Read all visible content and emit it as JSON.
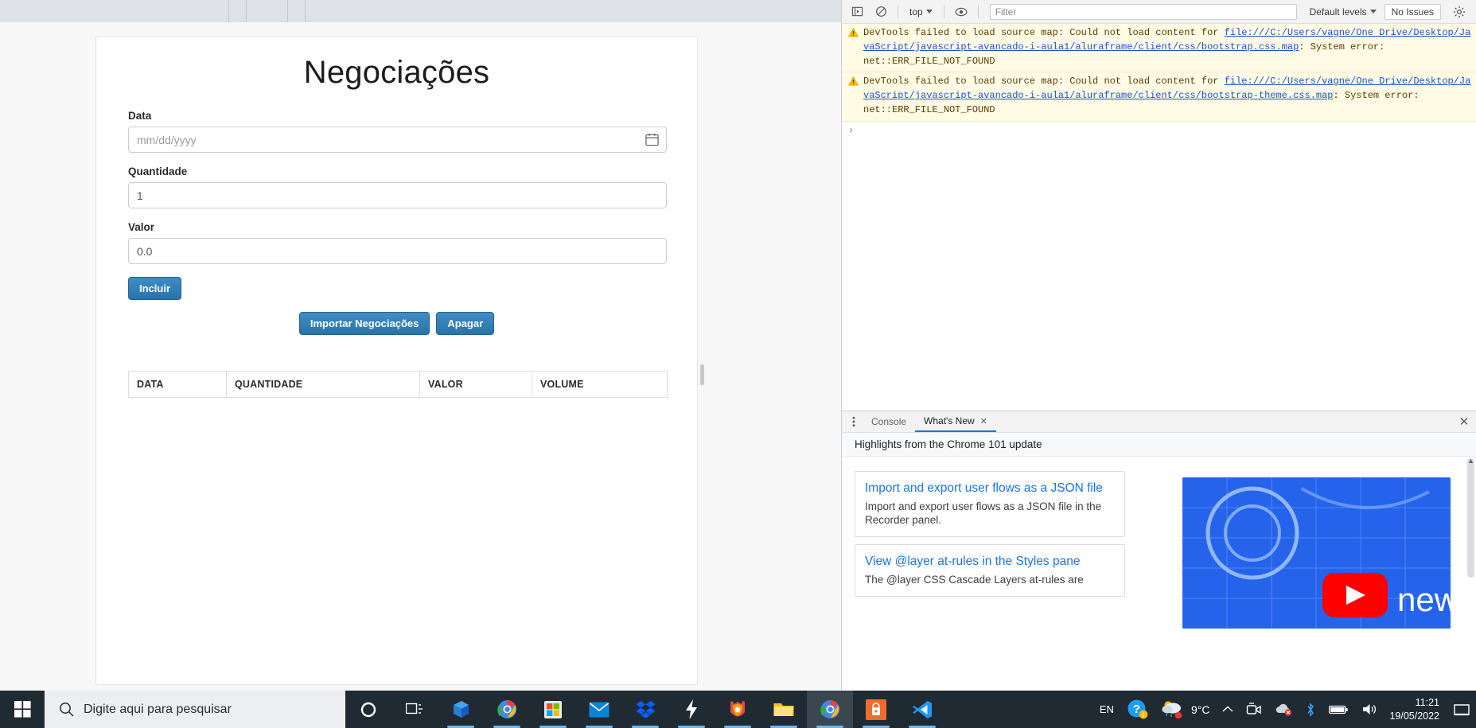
{
  "page": {
    "title": "Negociações",
    "fields": [
      {
        "label": "Data",
        "type": "date",
        "placeholder": "mm/dd/yyyy",
        "value": ""
      },
      {
        "label": "Quantidade",
        "type": "number",
        "placeholder": "",
        "value": "1"
      },
      {
        "label": "Valor",
        "type": "number",
        "placeholder": "",
        "value": "0.0"
      }
    ],
    "buttons": {
      "incluir": "Incluir",
      "importar": "Importar Negociações",
      "apagar": "Apagar"
    },
    "table": {
      "headers": [
        "DATA",
        "QUANTIDADE",
        "VALOR",
        "VOLUME"
      ],
      "rows": []
    }
  },
  "devtools": {
    "toolbar": {
      "context_label": "top",
      "filter_placeholder": "Filter",
      "levels_label": "Default levels",
      "issues_label": "No Issues"
    },
    "console_messages": [
      {
        "level": "warning",
        "prefix": "DevTools failed to load source map: Could not load content for ",
        "link": "file:///C:/Users/vagne/One Drive/Desktop/JavaScript/javascript-avancado-i-aula1/aluraframe/client/css/bootstrap.css.map",
        "suffix": ": System error: net::ERR_FILE_NOT_FOUND"
      },
      {
        "level": "warning",
        "prefix": "DevTools failed to load source map: Could not load content for ",
        "link": "file:///C:/Users/vagne/One Drive/Desktop/JavaScript/javascript-avancado-i-aula1/aluraframe/client/css/bootstrap-theme.css.map",
        "suffix": ": System error: net::ERR_FILE_NOT_FOUND"
      }
    ],
    "prompt_symbol": "›",
    "drawer": {
      "tabs": [
        {
          "label": "Console",
          "active": false,
          "closable": false
        },
        {
          "label": "What's New",
          "active": true,
          "closable": true
        }
      ],
      "subtitle": "Highlights from the Chrome 101 update",
      "cards": [
        {
          "title": "Import and export user flows as a JSON file",
          "desc": "Import and export user flows as a JSON file in the Recorder panel."
        },
        {
          "title": "View @layer at-rules in the Styles pane",
          "desc": "The @layer CSS Cascade Layers at-rules are"
        }
      ],
      "video_badge": "new"
    }
  },
  "taskbar": {
    "search_placeholder": "Digite aqui para pesquisar",
    "language": "EN",
    "weather": "9°C",
    "time": "11:21",
    "date": "19/05/2022",
    "apps": [
      "cortana-icon",
      "task-view-icon",
      "store-blue-icon",
      "chrome-icon",
      "microsoft-store-icon",
      "mail-icon",
      "dropbox-icon",
      "lightning-icon",
      "firefox-icon",
      "file-explorer-icon",
      "chrome-active-icon",
      "anydesk-icon",
      "vscode-icon"
    ]
  },
  "colors": {
    "accent_blue": "#2e7bb5",
    "devtools_link": "#1a52cc",
    "warning_bg": "#fffbe5",
    "tab_active": "#1a73e8",
    "taskbar_bg": "#1f2a33"
  }
}
